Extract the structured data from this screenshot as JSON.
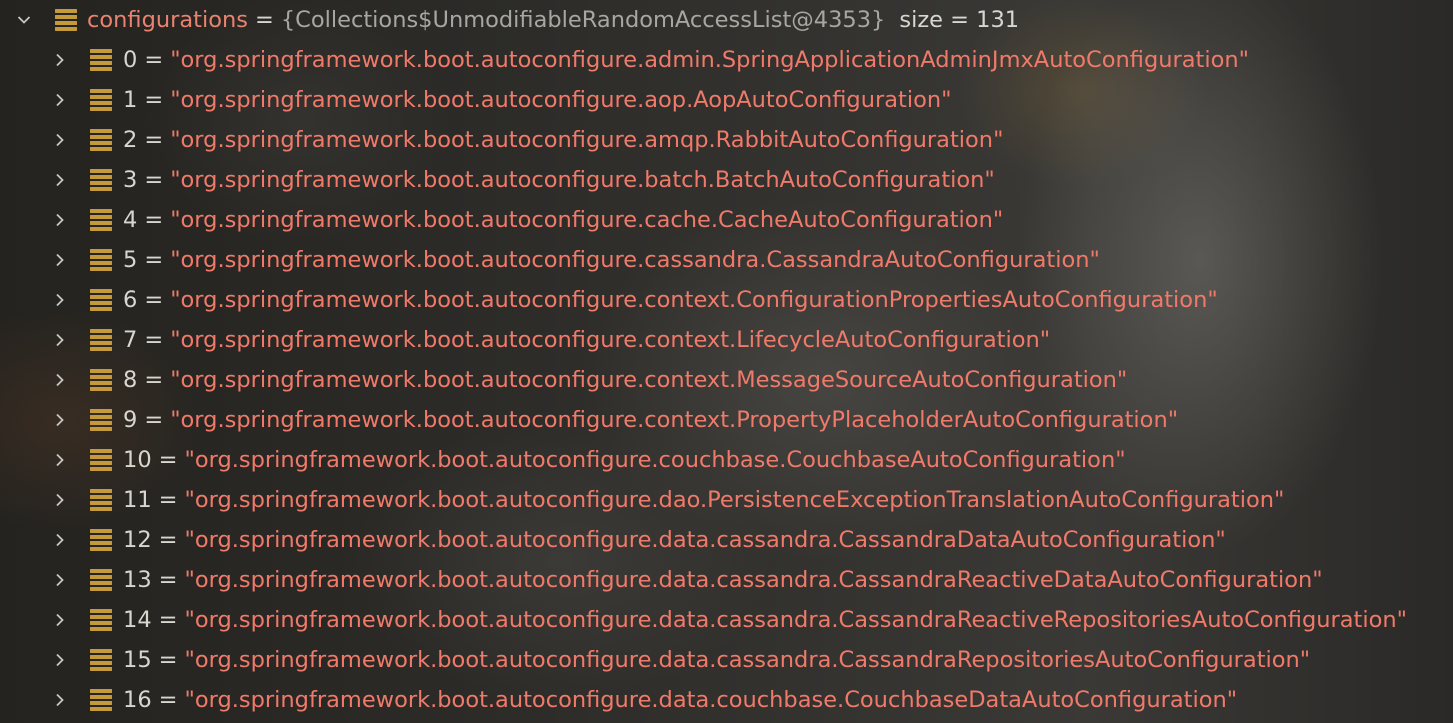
{
  "parent": {
    "name": "configurations",
    "equals": "=",
    "type_text": "{Collections$UnmodifiableRandomAccessList@4353}",
    "size_text": "size = 131",
    "expanded": true
  },
  "items": [
    {
      "index": "0",
      "equals": "=",
      "value": "\"org.springframework.boot.autoconfigure.admin.SpringApplicationAdminJmxAutoConfiguration\""
    },
    {
      "index": "1",
      "equals": "=",
      "value": "\"org.springframework.boot.autoconfigure.aop.AopAutoConfiguration\""
    },
    {
      "index": "2",
      "equals": "=",
      "value": "\"org.springframework.boot.autoconfigure.amqp.RabbitAutoConfiguration\""
    },
    {
      "index": "3",
      "equals": "=",
      "value": "\"org.springframework.boot.autoconfigure.batch.BatchAutoConfiguration\""
    },
    {
      "index": "4",
      "equals": "=",
      "value": "\"org.springframework.boot.autoconfigure.cache.CacheAutoConfiguration\""
    },
    {
      "index": "5",
      "equals": "=",
      "value": "\"org.springframework.boot.autoconfigure.cassandra.CassandraAutoConfiguration\""
    },
    {
      "index": "6",
      "equals": "=",
      "value": "\"org.springframework.boot.autoconfigure.context.ConfigurationPropertiesAutoConfiguration\""
    },
    {
      "index": "7",
      "equals": "=",
      "value": "\"org.springframework.boot.autoconfigure.context.LifecycleAutoConfiguration\""
    },
    {
      "index": "8",
      "equals": "=",
      "value": "\"org.springframework.boot.autoconfigure.context.MessageSourceAutoConfiguration\""
    },
    {
      "index": "9",
      "equals": "=",
      "value": "\"org.springframework.boot.autoconfigure.context.PropertyPlaceholderAutoConfiguration\""
    },
    {
      "index": "10",
      "equals": "=",
      "value": "\"org.springframework.boot.autoconfigure.couchbase.CouchbaseAutoConfiguration\""
    },
    {
      "index": "11",
      "equals": "=",
      "value": "\"org.springframework.boot.autoconfigure.dao.PersistenceExceptionTranslationAutoConfiguration\""
    },
    {
      "index": "12",
      "equals": "=",
      "value": "\"org.springframework.boot.autoconfigure.data.cassandra.CassandraDataAutoConfiguration\""
    },
    {
      "index": "13",
      "equals": "=",
      "value": "\"org.springframework.boot.autoconfigure.data.cassandra.CassandraReactiveDataAutoConfiguration\""
    },
    {
      "index": "14",
      "equals": "=",
      "value": "\"org.springframework.boot.autoconfigure.data.cassandra.CassandraReactiveRepositoriesAutoConfiguration\""
    },
    {
      "index": "15",
      "equals": "=",
      "value": "\"org.springframework.boot.autoconfigure.data.cassandra.CassandraRepositoriesAutoConfiguration\""
    },
    {
      "index": "16",
      "equals": "=",
      "value": "\"org.springframework.boot.autoconfigure.data.couchbase.CouchbaseDataAutoConfiguration\""
    }
  ],
  "icons": {
    "expanded": "chevron-down-icon",
    "collapsed": "chevron-right-icon",
    "field": "list-icon"
  },
  "colors": {
    "field_name": "#e9826f",
    "string_value": "#f07a6a",
    "field_icon": "#c59a3a",
    "meta_text": "#a8a6a2"
  }
}
